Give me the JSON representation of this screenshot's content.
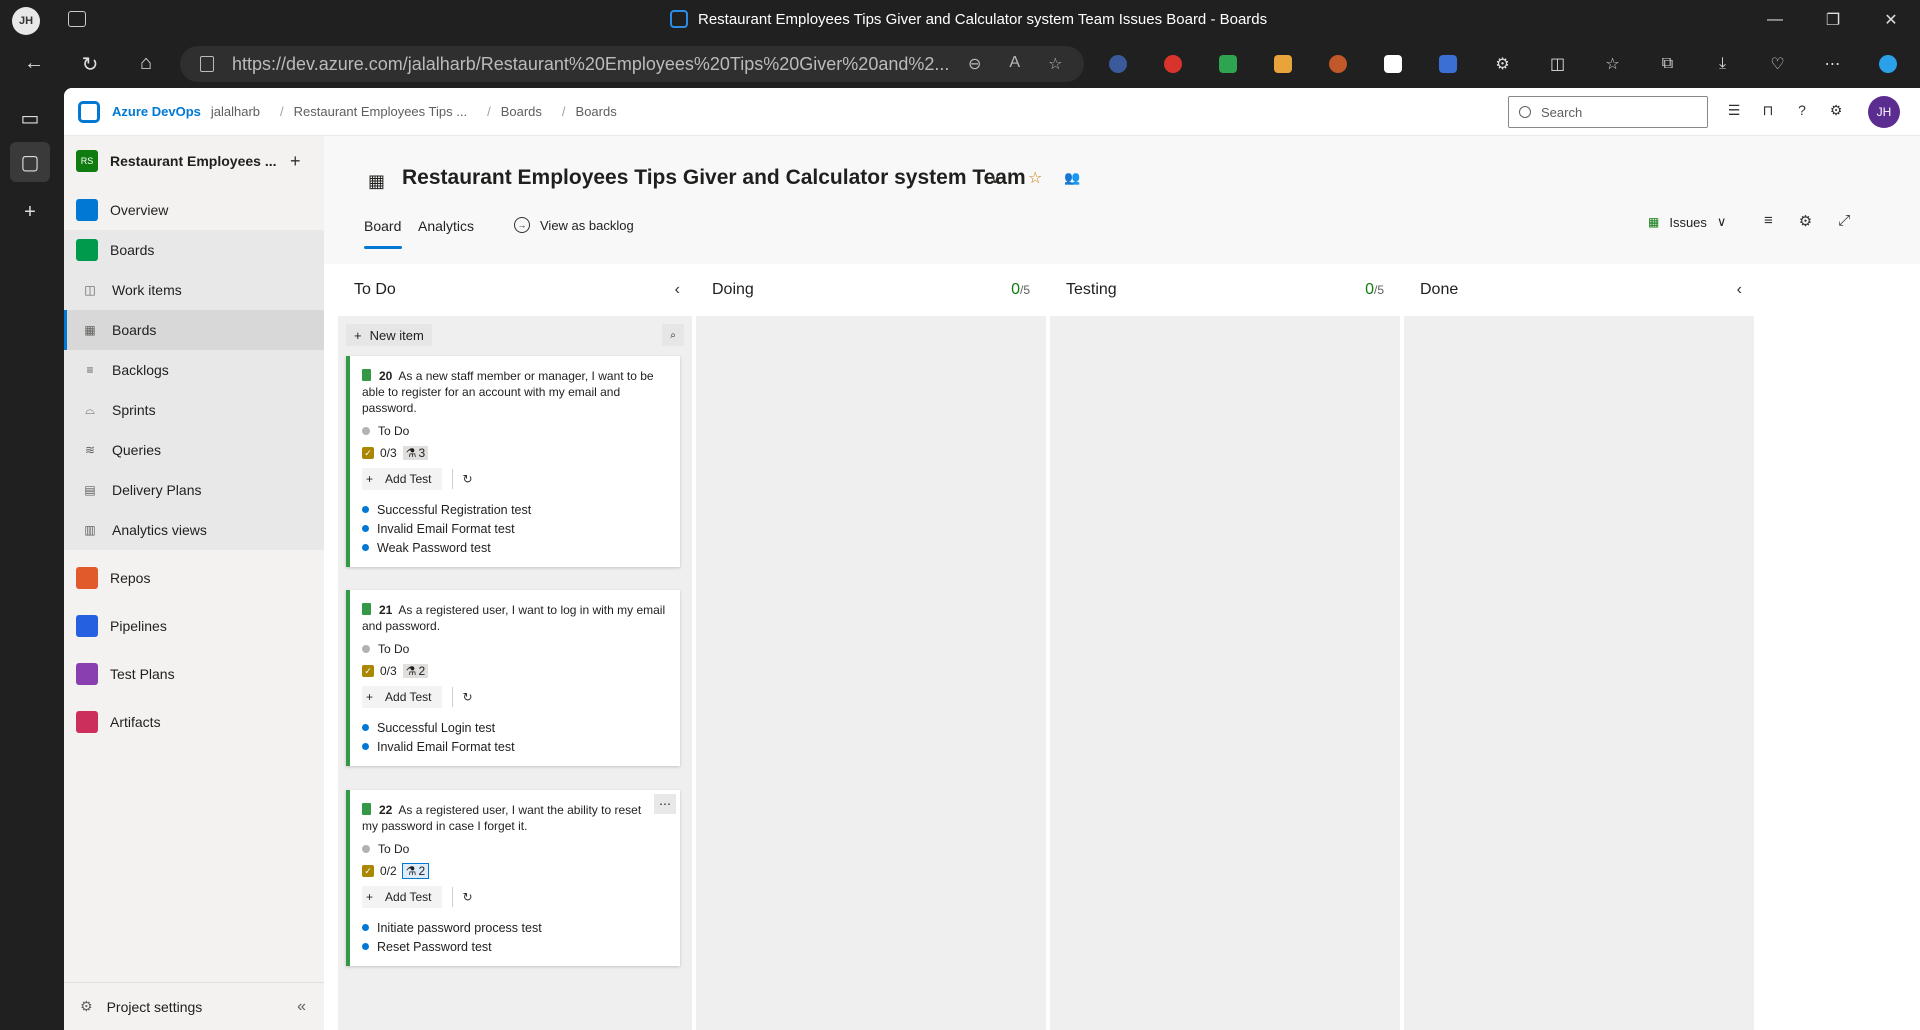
{
  "browser": {
    "avatar": "JH",
    "title": "Restaurant Employees Tips Giver and Calculator system Team Issues Board - Boards",
    "url": "https://dev.azure.com/jalalharb/Restaurant%20Employees%20Tips%20Giver%20and%2...",
    "win_min": "—",
    "win_max": "❐",
    "win_close": "✕"
  },
  "topnav": {
    "brand": "Azure DevOps",
    "org": "jalalharb",
    "breadcrumb": [
      "Restaurant Employees Tips ...",
      "Boards",
      "Boards"
    ],
    "search_placeholder": "Search",
    "user_initials": "JH"
  },
  "leftnav": {
    "project_badge": "RS",
    "project_name": "Restaurant Employees ...",
    "items": [
      {
        "label": "Overview",
        "color": "#0078d4"
      },
      {
        "label": "Boards",
        "color": "#009a4c"
      }
    ],
    "sub_items": [
      {
        "label": "Work items",
        "icon": "work-items-icon",
        "glyph": "◫"
      },
      {
        "label": "Boards",
        "icon": "boards-icon",
        "glyph": "▦"
      },
      {
        "label": "Backlogs",
        "icon": "backlogs-icon",
        "glyph": "≡"
      },
      {
        "label": "Sprints",
        "icon": "sprints-icon",
        "glyph": "⌓"
      },
      {
        "label": "Queries",
        "icon": "queries-icon",
        "glyph": "≋"
      },
      {
        "label": "Delivery Plans",
        "icon": "delivery-plans-icon",
        "glyph": "▤"
      },
      {
        "label": "Analytics views",
        "icon": "analytics-views-icon",
        "glyph": "▥"
      }
    ],
    "more_items": [
      {
        "label": "Repos",
        "color": "#e05a2b"
      },
      {
        "label": "Pipelines",
        "color": "#2560e0"
      },
      {
        "label": "Test Plans",
        "color": "#8a3fb0"
      },
      {
        "label": "Artifacts",
        "color": "#cc2f5a"
      }
    ],
    "settings_label": "Project settings"
  },
  "header": {
    "team_name": "Restaurant Employees Tips Giver and Calculator system Team",
    "tabs": [
      "Board",
      "Analytics"
    ],
    "view_as_backlog": "View as backlog",
    "backlog_level": "Issues"
  },
  "columns": [
    {
      "name": "To Do"
    },
    {
      "name": "Doing",
      "count": "0",
      "limit": "/5"
    },
    {
      "name": "Testing",
      "count": "0",
      "limit": "/5"
    },
    {
      "name": "Done"
    }
  ],
  "new_item_label": "New item",
  "cards": [
    {
      "id": "20",
      "title": "As a new staff member or manager, I want to be able to register for an account with my email and password.",
      "state": "To Do",
      "tasks": "0/3",
      "tests_count": "3",
      "add_test": "Add Test",
      "tests": [
        "Successful Registration test",
        "Invalid Email Format test",
        "Weak Password test"
      ]
    },
    {
      "id": "21",
      "title": "As a registered user, I want to log in with my email and password.",
      "state": "To Do",
      "tasks": "0/3",
      "tests_count": "2",
      "add_test": "Add Test",
      "tests": [
        "Successful Login test",
        "Invalid Email Format test"
      ]
    },
    {
      "id": "22",
      "title": "As a registered user, I want the ability to reset my password in case I forget it.",
      "state": "To Do",
      "tasks": "0/2",
      "tests_count": "2",
      "add_test": "Add Test",
      "tests": [
        "Initiate password process test",
        "Reset Password test"
      ]
    }
  ]
}
